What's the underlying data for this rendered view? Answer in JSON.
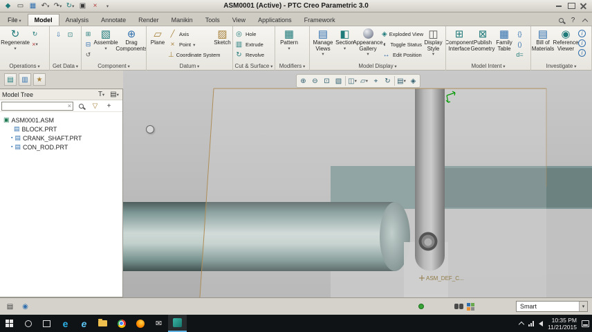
{
  "title_bar": {
    "title": "ASM0001 (Active) - PTC Creo Parametric 3.0"
  },
  "ribbon": {
    "file_label": "File",
    "tabs": [
      {
        "label": "Model",
        "active": true
      },
      {
        "label": "Analysis"
      },
      {
        "label": "Annotate"
      },
      {
        "label": "Render"
      },
      {
        "label": "Manikin"
      },
      {
        "label": "Tools"
      },
      {
        "label": "View"
      },
      {
        "label": "Applications"
      },
      {
        "label": "Framework"
      }
    ],
    "groups": [
      {
        "label": "Operations"
      },
      {
        "label": "Get Data"
      },
      {
        "label": "Component"
      },
      {
        "label": "Datum"
      },
      {
        "label": "Cut & Surface"
      },
      {
        "label": "Modifiers"
      },
      {
        "label": "Model Display"
      },
      {
        "label": "Model Intent"
      },
      {
        "label": "Investigate"
      }
    ],
    "buttons": {
      "regenerate": "Regenerate",
      "assemble": "Assemble",
      "drag_components": "Drag Components",
      "plane": "Plane",
      "axis": "Axis",
      "point": "Point",
      "coordinate_system": "Coordinate System",
      "sketch": "Sketch",
      "hole": "Hole",
      "extrude": "Extrude",
      "revolve": "Revolve",
      "pattern": "Pattern",
      "manage_views": "Manage Views",
      "section": "Section",
      "appearance_gallery": "Appearance Gallery",
      "exploded_view": "Exploded View",
      "toggle_status": "Toggle Status",
      "edit_position": "Edit Position",
      "display_style": "Display Style",
      "component_interface": "Component Interface",
      "publish_geometry": "Publish Geometry",
      "family_table": "Family Table",
      "bill_of_materials": "Bill of Materials",
      "reference_viewer": "Reference Viewer"
    }
  },
  "model_tree": {
    "header": "Model Tree",
    "items": [
      {
        "label": "ASM0001.ASM",
        "type": "assembly"
      },
      {
        "label": "BLOCK.PRT",
        "type": "part"
      },
      {
        "label": "CRANK_SHAFT.PRT",
        "type": "part",
        "marker": true
      },
      {
        "label": "CON_ROD.PRT",
        "type": "part",
        "marker": true
      }
    ]
  },
  "viewport": {
    "annotation": "ASM_DEF_C...",
    "toolbar": [
      {
        "name": "zoom-in",
        "glyph": "⊕"
      },
      {
        "name": "zoom-out",
        "glyph": "⊖"
      },
      {
        "name": "refit",
        "glyph": "⊡"
      },
      {
        "name": "repaint",
        "glyph": "▧"
      },
      {
        "name": "display-style",
        "glyph": "◫"
      },
      {
        "name": "datum-display-filters",
        "glyph": "▱"
      },
      {
        "name": "annotation-display",
        "glyph": "⌖"
      },
      {
        "name": "spin-center",
        "glyph": "↻"
      },
      {
        "name": "saved-orientations",
        "glyph": "▤"
      },
      {
        "name": "view-mode",
        "glyph": "◈"
      }
    ]
  },
  "status_bar": {
    "selection_filter": "Smart"
  },
  "taskbar": {
    "time": "10:35 PM",
    "date": "11/21/2015"
  },
  "colors": {
    "model_teal": "#7e9696",
    "edge_tan": "#ad8d58",
    "accent_teal": "#1f7a7a"
  },
  "icons": {
    "app_logo": "◆",
    "open": "▭",
    "save": "▦",
    "undo": "↶",
    "redo": "↷",
    "regenerate": "↻",
    "window": "▣",
    "close_x": "×",
    "help": "?",
    "import": "⇩",
    "copy_geometry": "⊡",
    "component_mini_1": "⊞",
    "component_mini_2": "⊟",
    "component_mini_3": "↺",
    "assemble": "▧",
    "drag_components": "⊕",
    "plane": "▱",
    "axis": "╱",
    "point": "×",
    "coordinate_system": "⊥",
    "sketch": "▨",
    "hole": "◎",
    "extrude": "▥",
    "revolve": "↻",
    "pattern": "▦",
    "manage_views": "▤",
    "section": "◧",
    "exploded_view": "◈",
    "toggle_status": "◐",
    "edit_position": "↔",
    "display_style": "◫",
    "component_interface": "⊞",
    "publish_geometry": "⊠",
    "family_table": "▦",
    "braces": "{}",
    "parens": "()",
    "dimension": "d=",
    "bill_of_materials": "▤",
    "reference_viewer": "◉",
    "info": "i",
    "tree_settings": "T",
    "tree_show": "▤",
    "filter": "▽",
    "plus": "+",
    "clear": "×",
    "assembly": "▣",
    "part": "▤",
    "body_marker": "▪",
    "nav_tree": "▤",
    "nav_folder": "▥",
    "nav_favorites": "★",
    "status_panel": "▤",
    "status_browser": "◉",
    "mail": "✉",
    "edge": "e",
    "ie": "e"
  }
}
